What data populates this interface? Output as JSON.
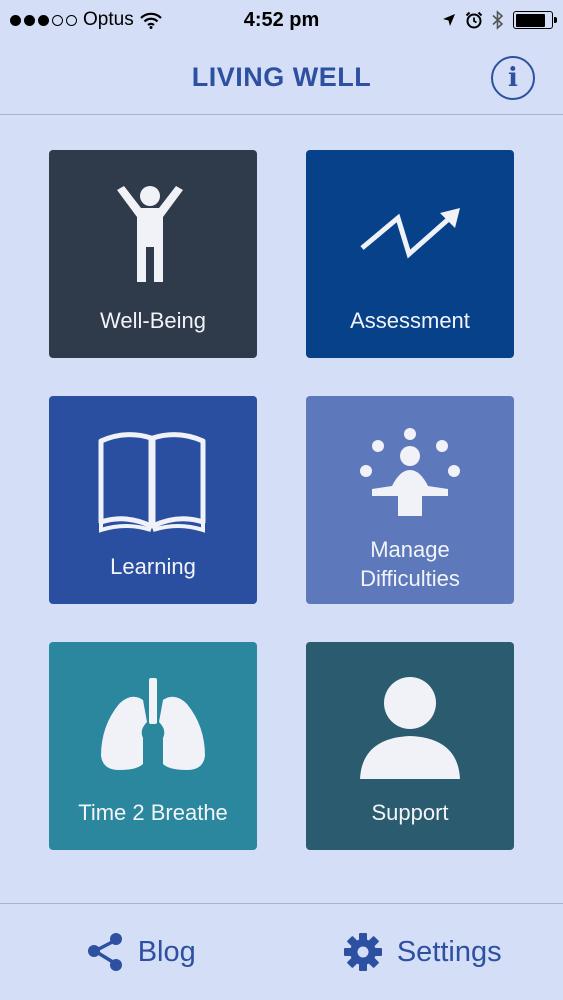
{
  "status_bar": {
    "carrier": "Optus",
    "time": "4:52 pm",
    "signal_bars_filled": 3,
    "signal_bars_total": 5,
    "battery_level": 0.85
  },
  "nav": {
    "title": "LIVING WELL",
    "info_label": "i"
  },
  "tiles": [
    {
      "label": "Well-Being",
      "icon": "person-arms-up-icon",
      "color": "#2f3a4a"
    },
    {
      "label": "Assessment",
      "icon": "trend-arrow-icon",
      "color": "#07418a"
    },
    {
      "label": "Learning",
      "icon": "open-book-icon",
      "color": "#2a4fa0"
    },
    {
      "label_line1": "Manage",
      "label_line2": "Difficulties",
      "icon": "juggling-person-icon",
      "color": "#5d79bb"
    },
    {
      "label": "Time 2 Breathe",
      "icon": "lungs-icon",
      "color": "#2b879e"
    },
    {
      "label": "Support",
      "icon": "person-silhouette-icon",
      "color": "#2b5b6e"
    }
  ],
  "tab_bar": {
    "blog_label": "Blog",
    "settings_label": "Settings"
  },
  "colors": {
    "accent": "#2e50a0",
    "background": "#d4def6"
  }
}
